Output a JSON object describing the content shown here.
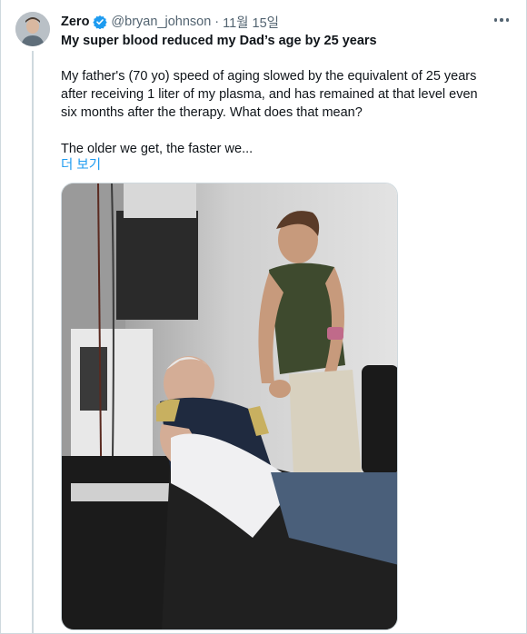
{
  "tweet": {
    "author_name": "Zero",
    "handle": "@bryan_johnson",
    "separator": "·",
    "date": "11월 15일",
    "title": "My super blood reduced my Dad’s age by 25 years",
    "paragraph_1": "My father's (70 yo) speed of aging slowed by the equivalent of 25 years after receiving 1 liter of my plasma, and has remained at that level even six months after the therapy. What does that mean?",
    "paragraph_2": "The older we get, the faster we...",
    "show_more": "더 보기"
  },
  "icons": {
    "verified": "verified-badge-icon",
    "more": "more-options-icon"
  },
  "colors": {
    "accent": "#1d9bf0",
    "secondary_text": "#536471",
    "primary_text": "#0f1419",
    "border": "#cfd9de"
  }
}
